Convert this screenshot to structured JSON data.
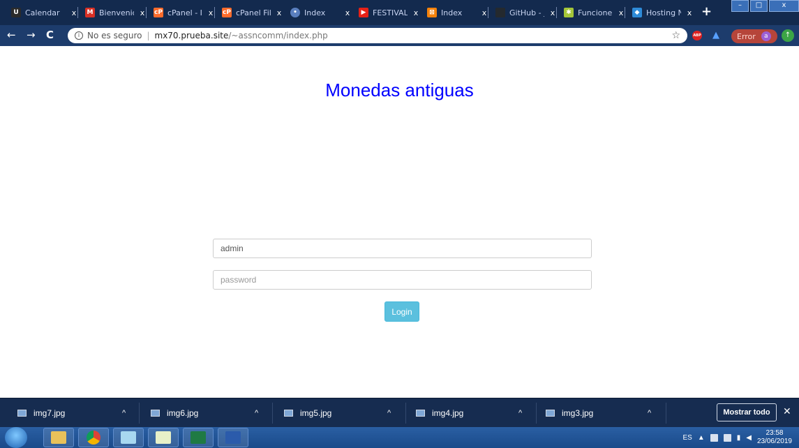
{
  "browser": {
    "tabs": [
      {
        "label": "Calendar",
        "icon": "udemy-icon",
        "color": "#2b2b2b"
      },
      {
        "label": "Bienvenid",
        "icon": "gmail-icon",
        "color": "#d93025"
      },
      {
        "label": "cPanel - I",
        "icon": "cpanel-icon",
        "color": "#ff6c2c"
      },
      {
        "label": "cPanel Fil",
        "icon": "cpanel-icon",
        "color": "#ff6c2c"
      },
      {
        "label": "Index",
        "icon": "globe-icon",
        "color": "#5a7fbf"
      },
      {
        "label": "FESTIVAL",
        "icon": "youtube-icon",
        "color": "#e62117"
      },
      {
        "label": "Index",
        "icon": "xampp-icon",
        "color": "#f5820b"
      },
      {
        "label": "GitHub - j",
        "icon": "github-icon",
        "color": "#24292e"
      },
      {
        "label": "Funcione",
        "icon": "android-icon",
        "color": "#a4c639"
      },
      {
        "label": "Hosting N",
        "icon": "hosting-icon",
        "color": "#2e8bd8"
      }
    ],
    "close_glyph": "x",
    "new_tab": "+",
    "window_buttons": {
      "minimize": "–",
      "maximize": "□",
      "close": "x"
    },
    "nav": {
      "back": "←",
      "forward": "→",
      "reload": "C"
    },
    "address": {
      "security": "No es seguro",
      "separator": "|",
      "host": "mx70.prueba.site",
      "path": "/~assncomm/index.php"
    },
    "bookmark_star": "☆",
    "abp_label": "ABP",
    "error_label": "Error",
    "profile_initial": "a"
  },
  "page": {
    "title": "Monedas antiguas",
    "username": {
      "value": "admin",
      "placeholder": ""
    },
    "password": {
      "value": "",
      "placeholder": "password"
    },
    "login_label": "Login"
  },
  "downloads": {
    "items": [
      "img7.jpg",
      "img6.jpg",
      "img5.jpg",
      "img4.jpg",
      "img3.jpg"
    ],
    "chevron": "^",
    "show_all": "Mostrar todo",
    "close": "✕"
  },
  "taskbar": {
    "language": "ES",
    "time": "23:58",
    "date": "23/06/2019",
    "apps": [
      "ie-icon",
      "explorer-icon",
      "chrome-icon",
      "folder-icon",
      "notepad-icon",
      "excel-icon",
      "word-icon"
    ]
  }
}
